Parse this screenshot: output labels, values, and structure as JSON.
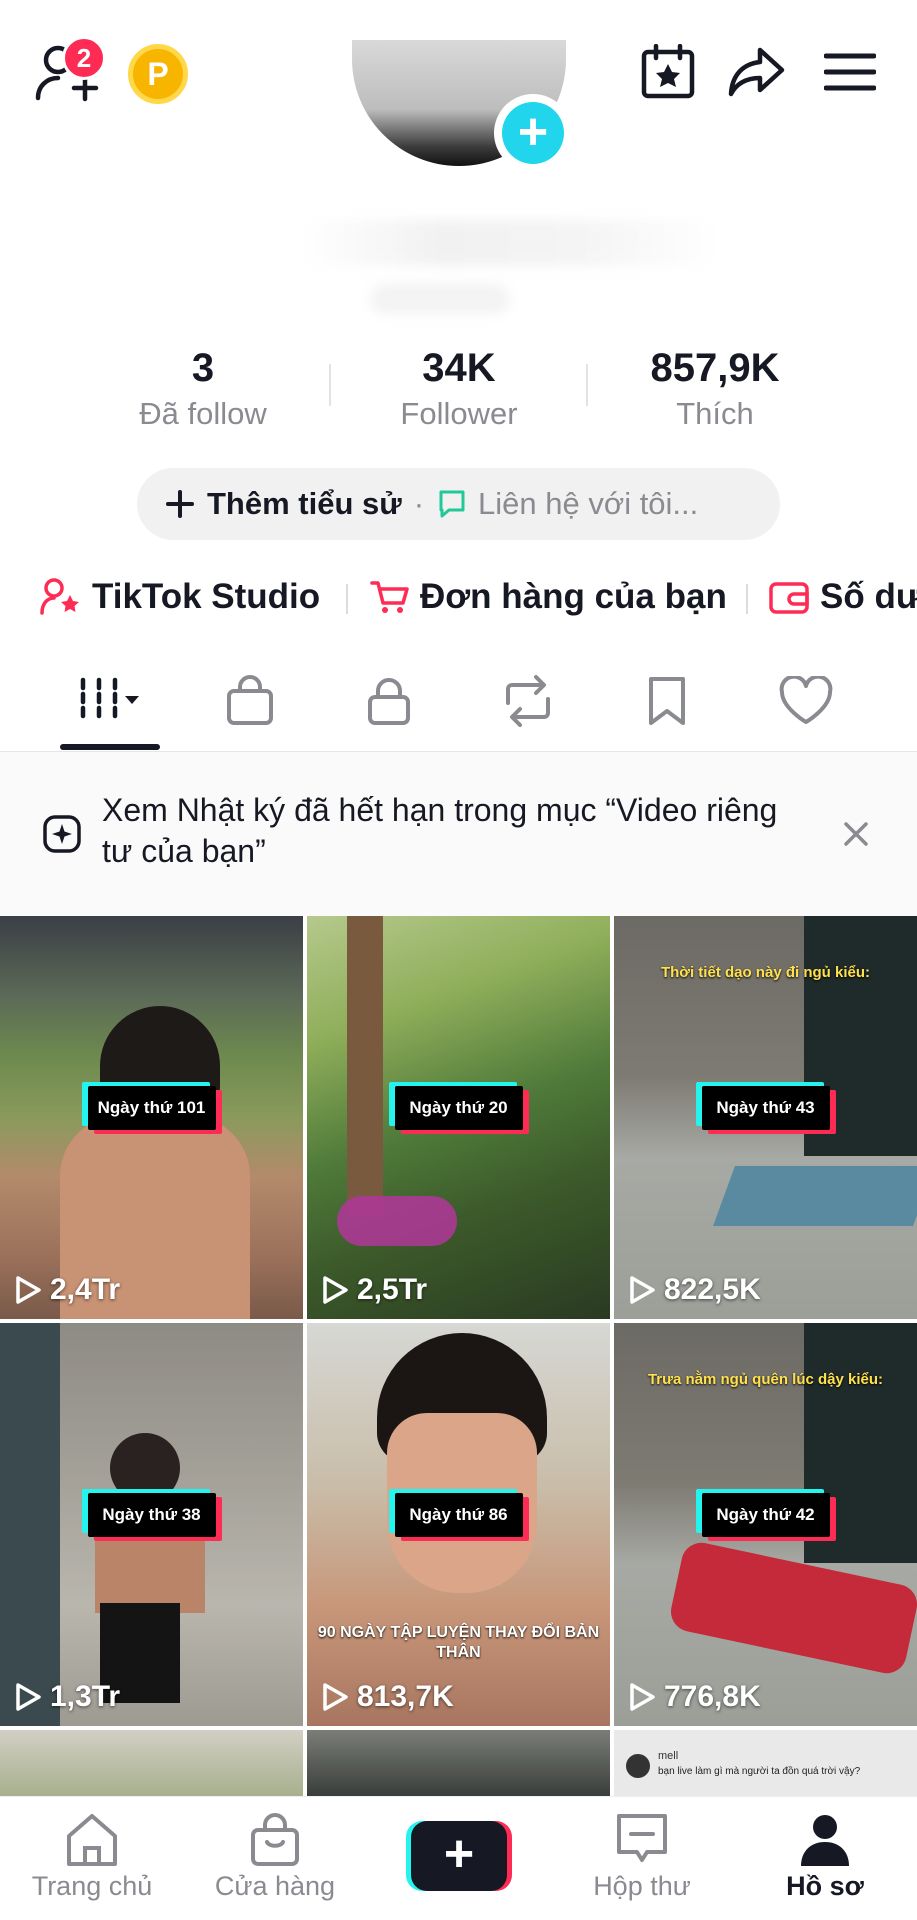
{
  "header": {
    "notification_count": "2",
    "coin_label": "P"
  },
  "stats": [
    {
      "value": "3",
      "label": "Đã follow"
    },
    {
      "value": "34K",
      "label": "Follower"
    },
    {
      "value": "857,9K",
      "label": "Thích"
    }
  ],
  "bio": {
    "add_label": "Thêm tiểu sử",
    "separator": "·",
    "contact_label": "Liên hệ với tôi..."
  },
  "shortcuts": [
    {
      "label": "TikTok Studio"
    },
    {
      "label": "Đơn hàng của bạn"
    },
    {
      "label": "Số dư"
    }
  ],
  "banner": {
    "text": "Xem Nhật ký đã hết hạn trong mục “Video riêng tư của bạn”"
  },
  "videos": [
    {
      "caption": "Ngày thứ 101",
      "views": "2,4Tr"
    },
    {
      "caption": "Ngày thứ 20",
      "views": "2,5Tr"
    },
    {
      "caption": "Ngày thứ 43",
      "views": "822,5K",
      "top_text": "Thời tiết dạo này đi ngủ kiểu:"
    },
    {
      "caption": "Ngày thứ 38",
      "views": "1,3Tr"
    },
    {
      "caption": "Ngày thứ 86",
      "views": "813,7K",
      "sub_text": "90 NGÀY TẬP LUYỆN THAY ĐỔI BẢN THÂN"
    },
    {
      "caption": "Ngày thứ 42",
      "views": "776,8K",
      "top_text": "Trưa nằm ngủ quên lúc dậy kiểu:"
    }
  ],
  "partial_row": {
    "comment_user": "mell",
    "comment_text": "bạn live làm gì mà người ta đồn quá trời vậy?"
  },
  "bottom_nav": [
    {
      "label": "Trang chủ"
    },
    {
      "label": "Cửa hàng"
    },
    {
      "label": "Hộp thư"
    },
    {
      "label": "Hồ sơ"
    }
  ],
  "colors": {
    "brand_red": "#fe2c55",
    "brand_cyan": "#25f4ee",
    "text_primary": "#161823",
    "text_secondary": "#8a8b91"
  }
}
